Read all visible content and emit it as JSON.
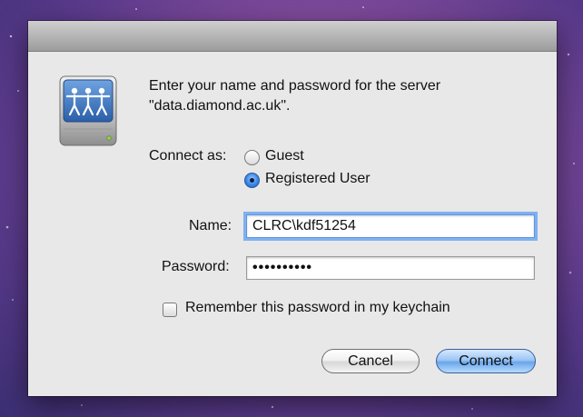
{
  "dialog": {
    "prompt_line1": "Enter your name and password for the server",
    "prompt_line2": "\"data.diamond.ac.uk\".",
    "connect_as_label": "Connect as:",
    "radio_guest": "Guest",
    "radio_registered": "Registered User",
    "selected_option": "Registered User",
    "name_label": "Name:",
    "name_value": "CLRC\\kdf51254",
    "password_label": "Password:",
    "password_value": "••••••••••",
    "remember_label": "Remember this password in my keychain",
    "remember_checked": false,
    "cancel_label": "Cancel",
    "connect_label": "Connect"
  },
  "icons": {
    "server": "network-server-icon"
  },
  "colors": {
    "accent": "#5b95e6",
    "default_button": "#6aa6ea",
    "dialog_bg": "#e8e8e8"
  }
}
